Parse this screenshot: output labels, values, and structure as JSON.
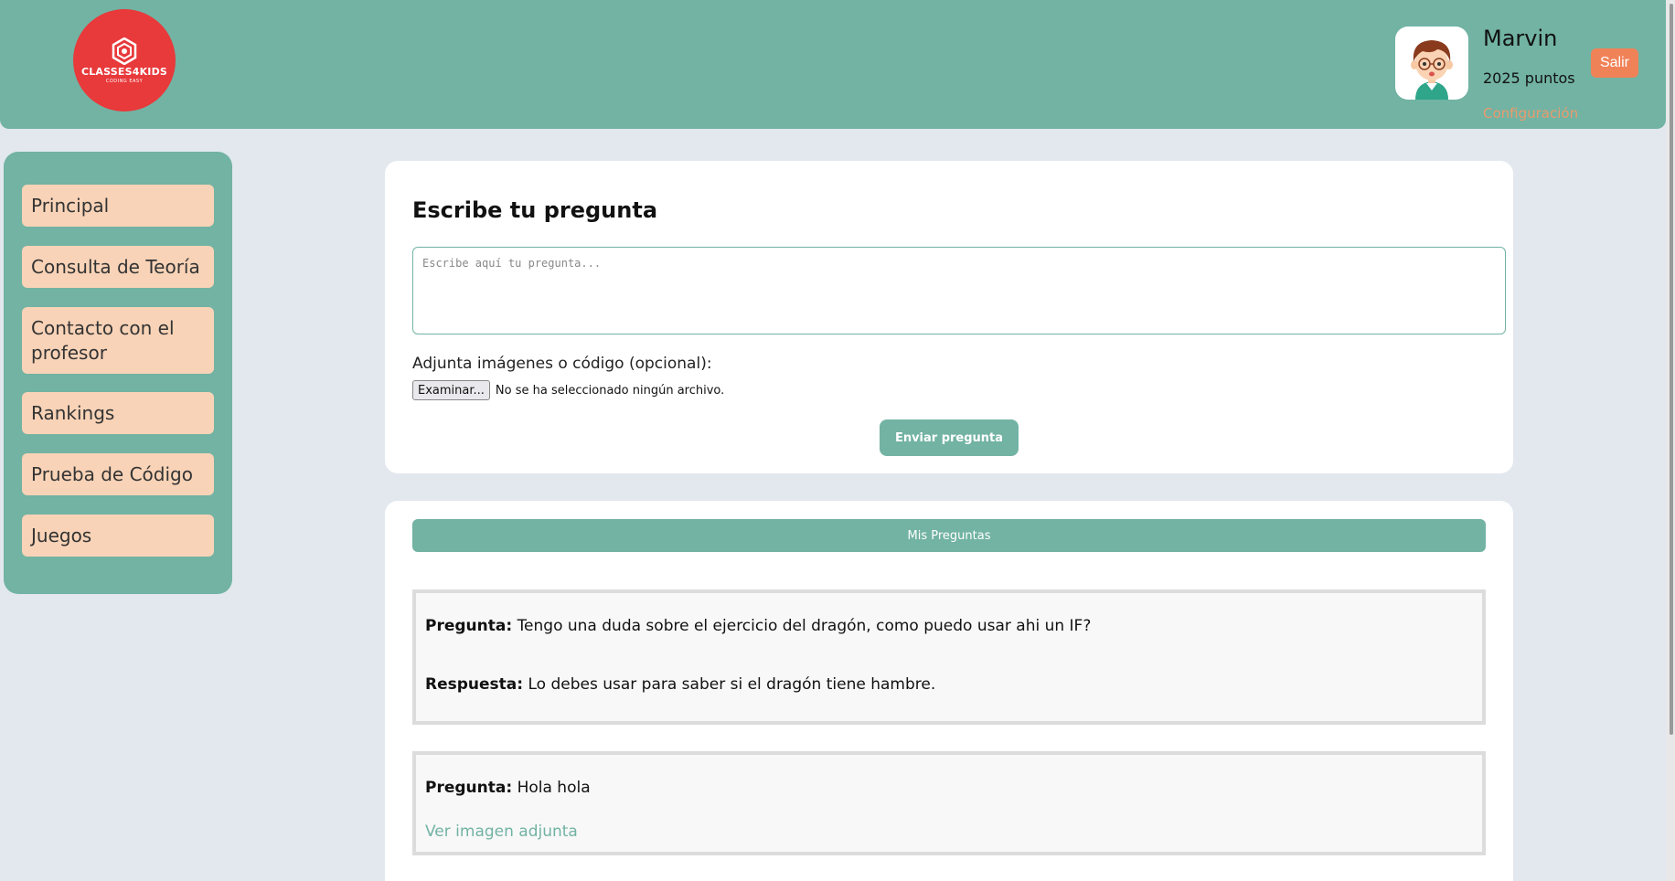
{
  "header": {
    "logo_text": "CLASSES4KIDS",
    "logo_sub": "CODING EASY",
    "user_name": "Marvin",
    "user_points": "2025 puntos",
    "config_label": "Configuración",
    "logout_label": "Salir"
  },
  "sidebar": {
    "items": [
      {
        "label": "Principal"
      },
      {
        "label": "Consulta de Teoría"
      },
      {
        "label": "Contacto con el profesor"
      },
      {
        "label": "Rankings"
      },
      {
        "label": "Prueba de Código"
      },
      {
        "label": "Juegos"
      }
    ]
  },
  "ask": {
    "title": "Escribe tu pregunta",
    "placeholder": "Escribe aquí tu pregunta...",
    "attach_label": "Adjunta imágenes o código (opcional):",
    "browse_label": "Examinar...",
    "file_status": "No se ha seleccionado ningún archivo.",
    "send_label": "Enviar pregunta"
  },
  "questions": {
    "header": "Mis Preguntas",
    "question_prefix": "Pregunta:",
    "answer_prefix": "Respuesta:",
    "items": [
      {
        "question": "Tengo una duda sobre el ejercicio del dragón, como puedo usar ahi un IF?",
        "answer": "Lo debes usar para saber si el dragón tiene hambre."
      },
      {
        "question": "Hola hola",
        "attachment_link": "Ver imagen adjunta"
      }
    ]
  },
  "colors": {
    "teal": "#72b3a3",
    "peach": "#f8d3b7",
    "logo_red": "#e8393b",
    "logout_orange": "#f08258"
  }
}
